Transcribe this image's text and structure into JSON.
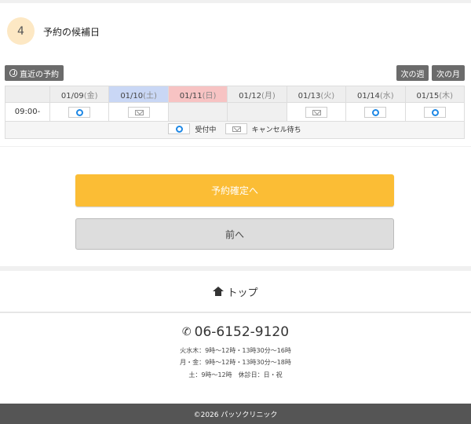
{
  "step": {
    "number": "4",
    "title": "予約の候補日"
  },
  "controls": {
    "recent_label": "直近の予約",
    "next_week_label": "次の週",
    "next_month_label": "次の月"
  },
  "calendar": {
    "days": [
      {
        "date": "01/09",
        "dow": "(金)",
        "type": "weekday"
      },
      {
        "date": "01/10",
        "dow": "(土)",
        "type": "sat"
      },
      {
        "date": "01/11",
        "dow": "(日)",
        "type": "sun"
      },
      {
        "date": "01/12",
        "dow": "(月)",
        "type": "weekday"
      },
      {
        "date": "01/13",
        "dow": "(火)",
        "type": "weekday"
      },
      {
        "date": "01/14",
        "dow": "(水)",
        "type": "weekday"
      },
      {
        "date": "01/15",
        "dow": "(木)",
        "type": "weekday"
      }
    ],
    "rows": [
      {
        "time": "09:00-",
        "slots": [
          "available",
          "waitlist",
          "none",
          "none",
          "waitlist",
          "available",
          "available"
        ]
      }
    ],
    "legend": {
      "available_label": "受付中",
      "waitlist_label": "キャンセル待ち"
    }
  },
  "actions": {
    "confirm_label": "予約確定へ",
    "back_label": "前へ"
  },
  "nav": {
    "top_label": "トップ"
  },
  "clinic": {
    "phone": "06-6152-9120",
    "hours": [
      "火水木：9時～12時・13時30分～16時",
      "月・金：9時～12時・13時30分～18時",
      "土：9時～12時　休診日：日・祝"
    ]
  },
  "footer": {
    "copyright": "©2026 パッソクリニック"
  },
  "colors": {
    "confirm": "#fbbd35",
    "available": "#1e88e5",
    "saturday": "#c9d7f5",
    "sunday": "#f7c3c3",
    "footer": "#555555"
  }
}
